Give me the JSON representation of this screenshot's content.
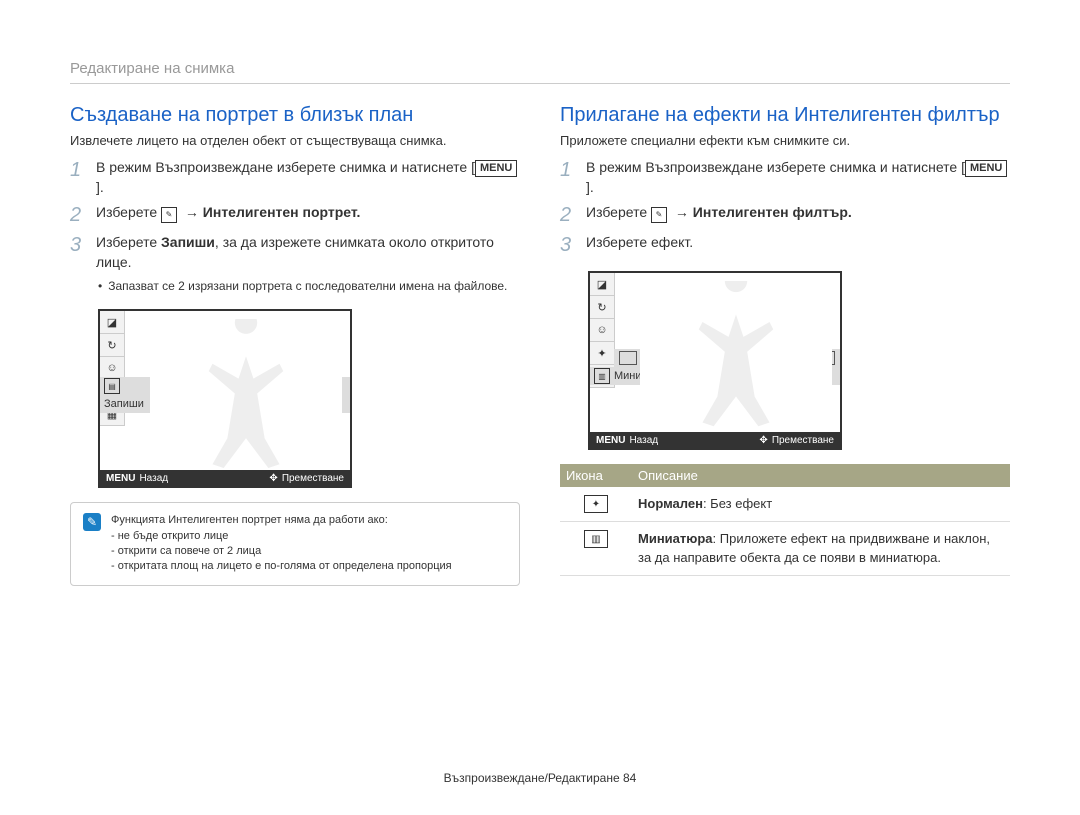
{
  "header": "Редактиране на снимка",
  "left": {
    "title": "Създаване на портрет в близък план",
    "subtitle": "Извлечете лицето на отделен обект от съществуваща снимка.",
    "step1_a": "В режим Възпроизвеждане изберете снимка и натиснете [",
    "step1_btn": "MENU",
    "step1_b": "].",
    "step2_a": "Изберете ",
    "step2_b": " → Интелигентен портрет.",
    "step3_a": "Изберете ",
    "step3_bold": "Запиши",
    "step3_b": ", за да изрежете снимката около откритото лице.",
    "bullet": "Запазват се 2 изрязани портрета с последователни имена на файлове.",
    "screen_label": "Запиши",
    "back": "Назад",
    "move": "Преместване",
    "menu_txt": "MENU",
    "info_title": "Функцията Интелигентен портрет няма да работи ако:",
    "info1": "не бъде открито лице",
    "info2": "открити са повече от 2 лица",
    "info3": "откритата площ на лицето е по-голяма от определена пропорция"
  },
  "right": {
    "title": "Прилагане на ефекти на Интелигентен филтър",
    "subtitle": "Приложете специални ефекти към снимките си.",
    "step1_a": "В режим Възпроизвеждане изберете снимка и натиснете [",
    "step1_btn": "MENU",
    "step1_b": "].",
    "step2_a": "Изберете ",
    "step2_b": " → Интелигентен филтър.",
    "step3": "Изберете ефект.",
    "screen_label": "Миниатюра",
    "back": "Назад",
    "move": "Преместване",
    "menu_txt": "MENU",
    "table_h1": "Икона",
    "table_h2": "Описание",
    "row1_bold": "Нормален",
    "row1_text": ": Без ефект",
    "row2_bold": "Миниатюра",
    "row2_text": ": Приложете ефект на придвижване и наклон, за да направите обекта да се появи в миниатюра."
  },
  "footer": "Възпроизвеждане/Редактиране  84"
}
